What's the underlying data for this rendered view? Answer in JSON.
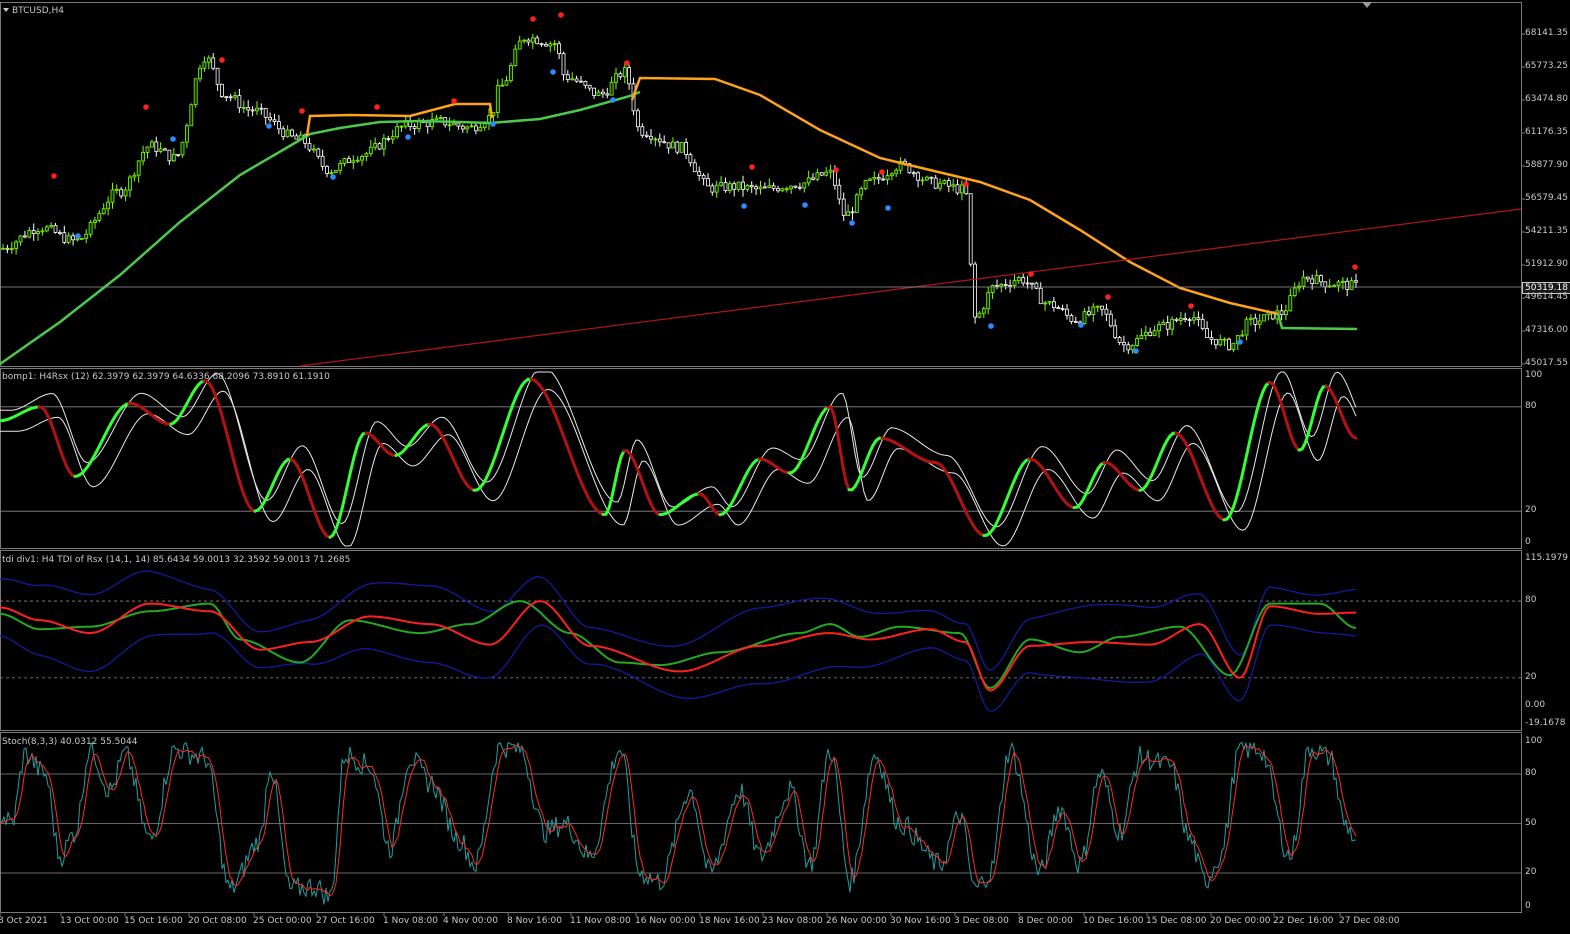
{
  "symbol_label": "BTCUSD,H4",
  "current_price": "50319.18",
  "panels": {
    "rsx_label": "bomp1: H4Rsx (12) 62.3979 62.3979 64.6336 68.2096 73.8910 61.1910",
    "tdi_label": "tdi div1: H4 TDI of Rsx  (14,1, 14) 85.6434 59.0013 32.3592 59.0013 71.2685",
    "stoch_label": "Stoch(8,3,3) 40.0312 55.5044"
  },
  "price_axis": [
    "68141.35",
    "65773.25",
    "63474.80",
    "61176.35",
    "58877.90",
    "56579.45",
    "54211.35",
    "51912.90",
    "49614.45",
    "47316.00",
    "45017.55"
  ],
  "rsx_axis": [
    "100",
    "80",
    "20",
    "0"
  ],
  "tdi_axis": [
    "115.1979",
    "80",
    "20",
    "0.00",
    "-19.1678"
  ],
  "stoch_axis": [
    "100",
    "80",
    "50",
    "20",
    "0"
  ],
  "time_axis": [
    "8 Oct 2021",
    "13 Oct 00:00",
    "15 Oct 16:00",
    "20 Oct 08:00",
    "25 Oct 00:00",
    "27 Oct 16:00",
    "1 Nov 08:00",
    "4 Nov 00:00",
    "8 Nov 16:00",
    "11 Nov 08:00",
    "16 Nov 00:00",
    "18 Nov 16:00",
    "23 Nov 08:00",
    "26 Nov 00:00",
    "30 Nov 16:00",
    "3 Dec 08:00",
    "8 Dec 00:00",
    "10 Dec 16:00",
    "15 Dec 08:00",
    "20 Dec 00:00",
    "22 Dec 16:00",
    "27 Dec 08:00"
  ],
  "colors": {
    "bull_candle": "#7fff00",
    "bear_candle": "#ffffff",
    "ma_up": "#4cc94c",
    "ma_down": "#ffa31a",
    "trendline": "#b01818",
    "fractal_up": "#ff2020",
    "fractal_down": "#2a8cff",
    "rsx_up": "#33ff33",
    "rsx_down": "#b31212",
    "tdi_band": "#141a9c",
    "tdi_fast": "#22aa22",
    "tdi_slow": "#ff2020",
    "stoch_main": "#20a0a0",
    "stoch_signal": "#ff2a2a"
  },
  "chart_data": [
    {
      "type": "candlestick",
      "title": "BTCUSD,H4",
      "x": [
        "8 Oct 2021",
        "13 Oct 00:00",
        "15 Oct 16:00",
        "20 Oct 08:00",
        "25 Oct 00:00",
        "27 Oct 16:00",
        "1 Nov 08:00",
        "4 Nov 00:00",
        "8 Nov 16:00",
        "11 Nov 08:00",
        "16 Nov 00:00",
        "18 Nov 16:00",
        "23 Nov 08:00",
        "26 Nov 00:00",
        "30 Nov 16:00",
        "3 Dec 08:00",
        "8 Dec 00:00",
        "10 Dec 16:00",
        "15 Dec 08:00",
        "20 Dec 00:00",
        "22 Dec 16:00",
        "27 Dec 08:00"
      ],
      "close_approx": [
        54400,
        56200,
        62000,
        66400,
        61800,
        59000,
        61500,
        61600,
        67200,
        64500,
        61200,
        57100,
        56900,
        56500,
        57800,
        48400,
        50200,
        47900,
        47600,
        46900,
        49400,
        50319.18
      ],
      "ylim": [
        45017.55,
        69000
      ],
      "last_price": 50319.18
    },
    {
      "type": "line",
      "title": "bomp1: H4Rsx (12)",
      "ylim": [
        0,
        100
      ],
      "levels": [
        80,
        20
      ],
      "series": [
        {
          "values": [
            70,
            78,
            88,
            97,
            28,
            8,
            65,
            64,
            30,
            90,
            40,
            12,
            52,
            22,
            75,
            78,
            55,
            60,
            70,
            25,
            92,
            61
          ]
        }
      ]
    },
    {
      "type": "line",
      "title": "tdi div1: H4 TDI of Rsx  (14,1, 14)",
      "ylim": [
        -19.1678,
        115.1979
      ],
      "levels": [
        80,
        20
      ],
      "series": [
        {
          "values": [
            85,
            72,
            65,
            78,
            55,
            48,
            60,
            70,
            85,
            72,
            40,
            30,
            48,
            52,
            58,
            20,
            42,
            50,
            55,
            42,
            76,
            71.27
          ]
        },
        {
          "values": [
            78,
            60,
            55,
            72,
            38,
            30,
            58,
            58,
            80,
            60,
            35,
            25,
            42,
            60,
            48,
            12,
            45,
            44,
            60,
            30,
            75,
            59.0
          ]
        }
      ]
    },
    {
      "type": "line",
      "title": "Stoch(8,3,3)",
      "ylim": [
        0,
        100
      ],
      "levels": [
        80,
        50,
        20
      ],
      "series": [
        {
          "values": [
            50,
            92,
            80,
            95,
            18,
            25,
            85,
            70,
            98,
            40,
            60,
            20,
            55,
            30,
            85,
            10,
            82,
            30,
            88,
            25,
            92,
            40.03
          ]
        },
        {
          "values": [
            55,
            88,
            82,
            90,
            22,
            28,
            80,
            72,
            95,
            45,
            58,
            25,
            50,
            35,
            80,
            15,
            78,
            35,
            85,
            30,
            90,
            55.5
          ]
        }
      ]
    }
  ]
}
